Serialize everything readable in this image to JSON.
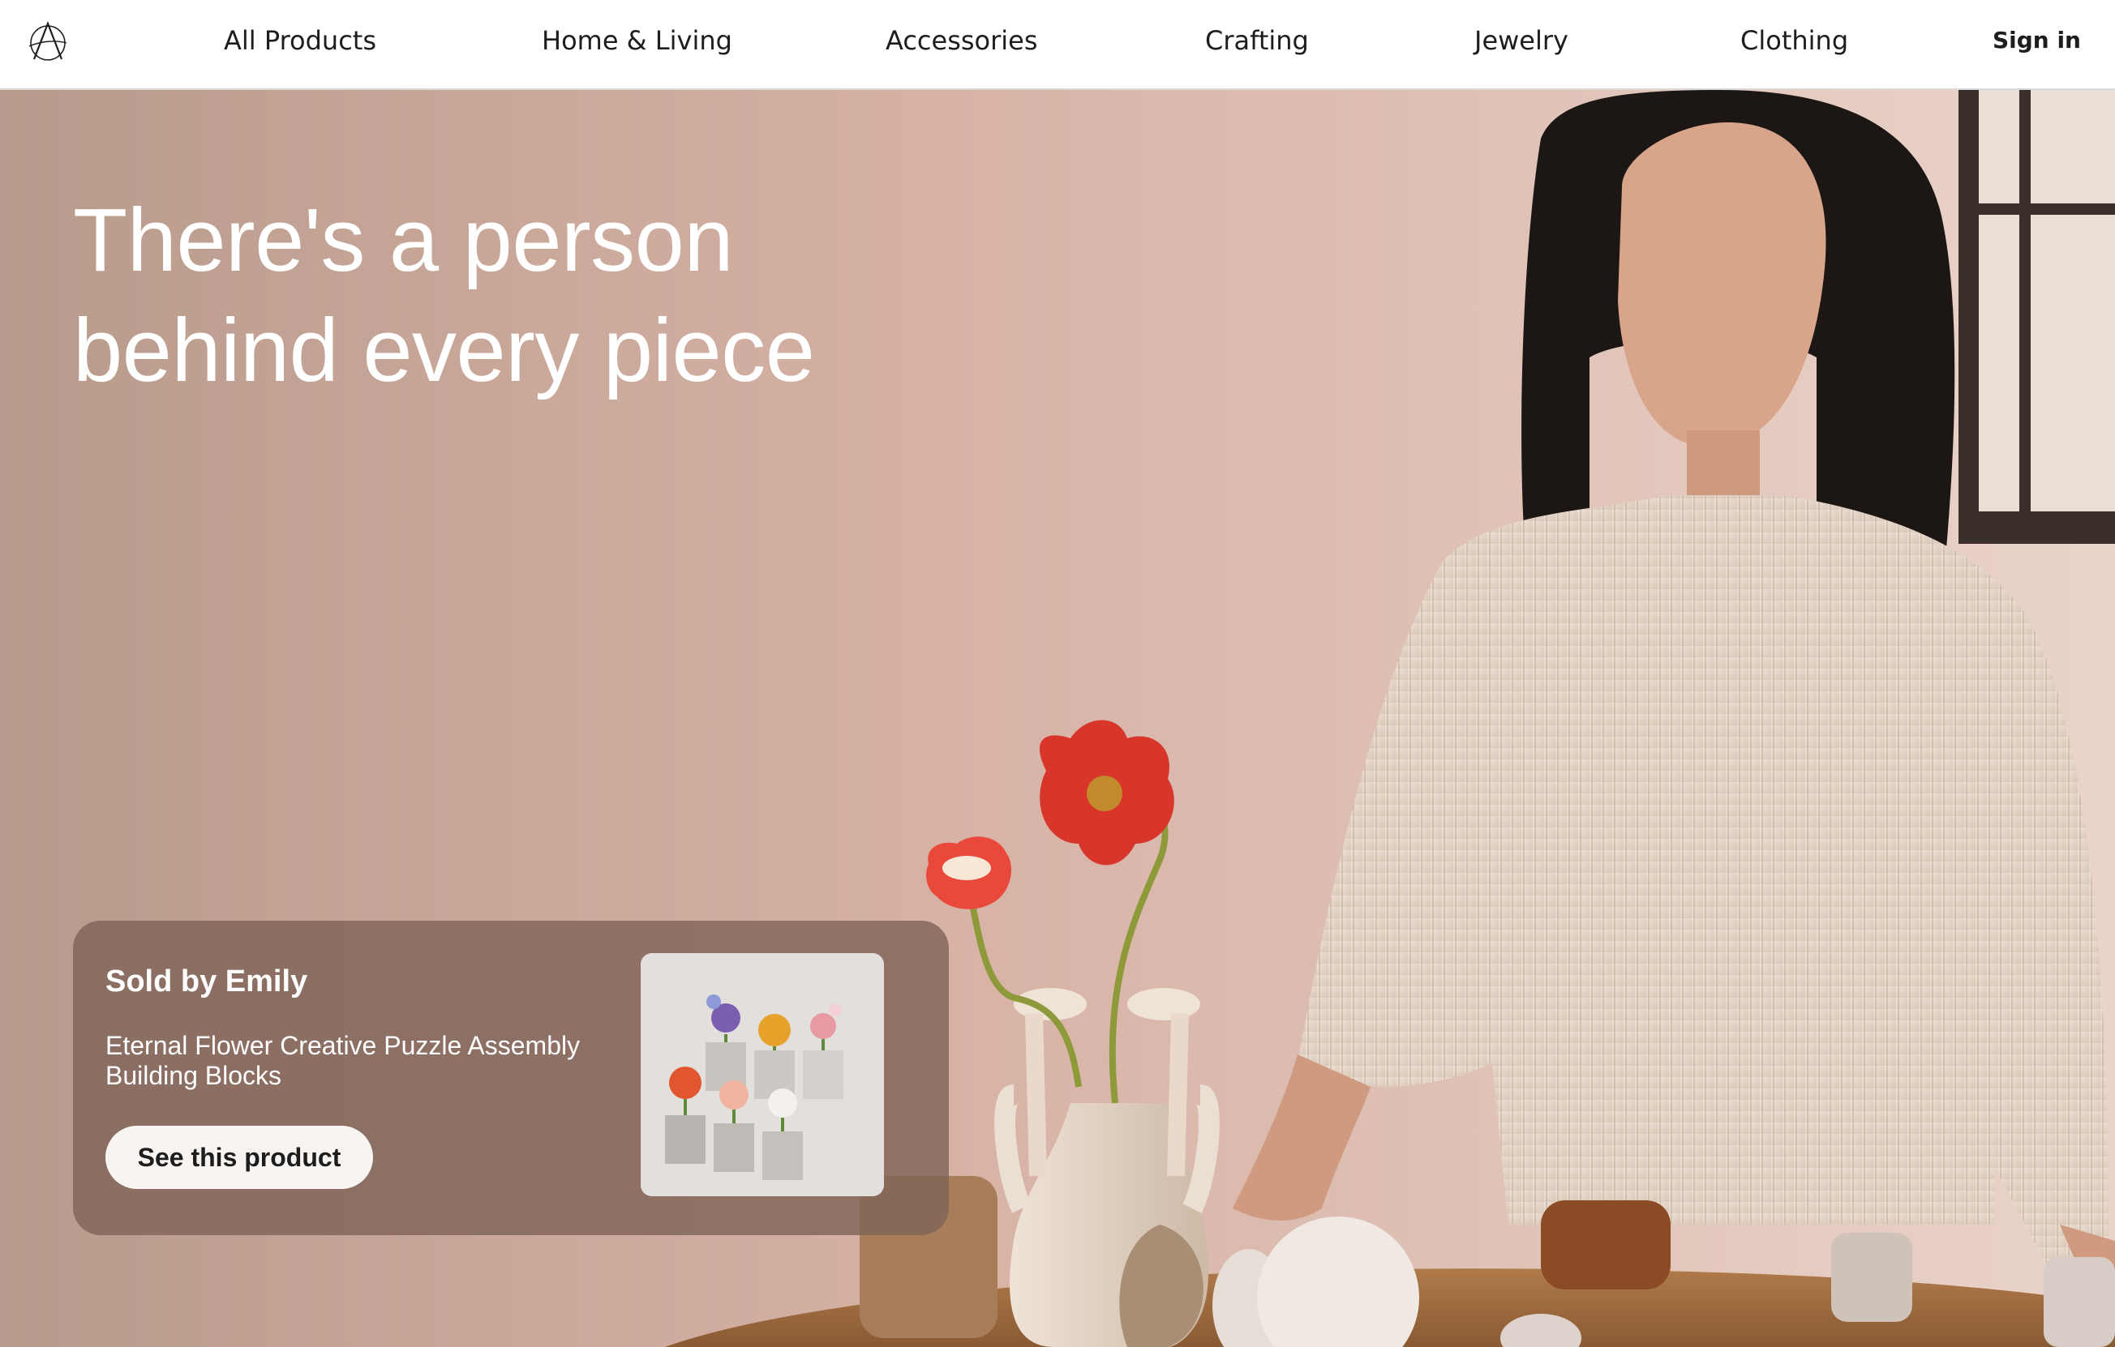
{
  "header": {
    "logo_icon": "a-monogram-logo-icon",
    "nav": [
      {
        "label": "All Products"
      },
      {
        "label": "Home & Living"
      },
      {
        "label": "Accessories"
      },
      {
        "label": "Crafting"
      },
      {
        "label": "Jewelry"
      },
      {
        "label": "Clothing"
      }
    ],
    "sign_in_label": "Sign in"
  },
  "hero": {
    "headline_line1": "There's a person",
    "headline_line2": "behind every piece",
    "image_icon": "artisan-with-vase-photo"
  },
  "product_card": {
    "seller": "Sold by Emily",
    "title": "Eternal Flower Creative Puzzle Assembly Building Blocks",
    "button_label": "See this product",
    "thumbnail_icon": "flower-blocks-thumbnail"
  },
  "colors": {
    "card_bg": "#806458",
    "button_bg": "#f8f4f1",
    "text_dark": "#1d1d1d",
    "poppy_red": "#d8362b"
  }
}
